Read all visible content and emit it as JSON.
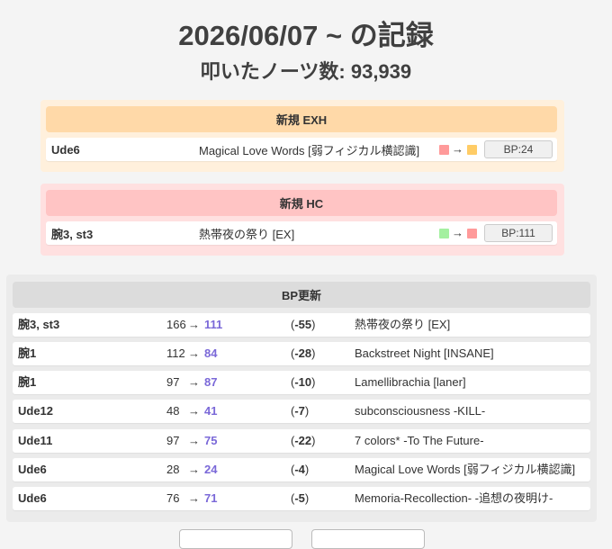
{
  "header": {
    "title": "2026/06/07 ~ の記録",
    "notes_label": "叩いたノーツ数: 93,939"
  },
  "colors": {
    "exh_head": "#ffd9a8",
    "exh_bg": "#fff0dc",
    "hc_head": "#ffc4c4",
    "hc_bg": "#ffe0e0",
    "bp_head": "#dcdcdc",
    "bp_bg": "#ebebeb",
    "lamp_hard": "#ff9a9a",
    "lamp_exh": "#ffcc66",
    "lamp_clear": "#a4f0a0",
    "new_bp": "#7a68d8"
  },
  "new_exh": {
    "heading": "新規 EXH",
    "rows": [
      {
        "player": "Ude6",
        "song": "Magical Love Words [弱フィジカル横認識]",
        "from_lamp": "hard",
        "to_lamp": "exh",
        "bp": "BP:24"
      }
    ]
  },
  "new_hc": {
    "heading": "新規 HC",
    "rows": [
      {
        "player": "腕3, st3",
        "song": "熱帯夜の祭り [EX]",
        "from_lamp": "clear",
        "to_lamp": "hard",
        "bp": "BP:111"
      }
    ]
  },
  "bp_update": {
    "heading": "BP更新",
    "arrow": "→",
    "rows": [
      {
        "player": "腕3, st3",
        "old": "166",
        "new": "111",
        "diff": "-55",
        "song": "熱帯夜の祭り [EX]"
      },
      {
        "player": "腕1",
        "old": "112",
        "new": "84",
        "diff": "-28",
        "song": "Backstreet Night [INSANE]"
      },
      {
        "player": "腕1",
        "old": "97",
        "new": "87",
        "diff": "-10",
        "song": "Lamellibrachia [laner]"
      },
      {
        "player": "Ude12",
        "old": "48",
        "new": "41",
        "diff": "-7",
        "song": "subconsciousness -KILL-"
      },
      {
        "player": "Ude11",
        "old": "97",
        "new": "75",
        "diff": "-22",
        "song": "7 colors* -To The Future-"
      },
      {
        "player": "Ude6",
        "old": "28",
        "new": "24",
        "diff": "-4",
        "song": "Magical Love Words [弱フィジカル横認識]"
      },
      {
        "player": "Ude6",
        "old": "76",
        "new": "71",
        "diff": "-5",
        "song": "Memoria-Recollection- -追想の夜明け-"
      }
    ]
  }
}
